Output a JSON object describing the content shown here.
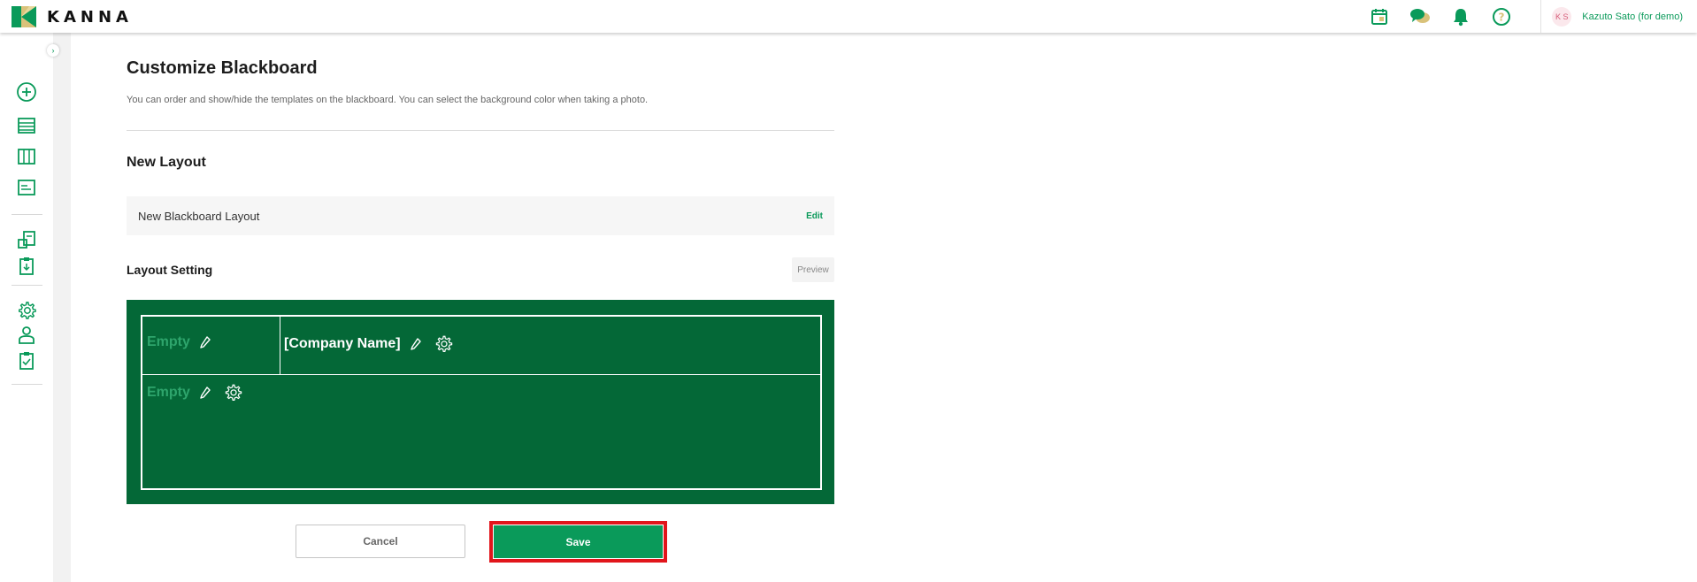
{
  "header": {
    "brand": "KANNA",
    "user_initials": "K S",
    "user_name": "Kazuto Sato (for demo)",
    "icons": [
      "calendar-icon",
      "chat-icon",
      "bell-icon",
      "help-icon"
    ]
  },
  "sidebar": {
    "toggle": "›",
    "icons": [
      "add-circle-icon",
      "list-icon",
      "columns-icon",
      "card-icon",
      "documents-icon",
      "clipboard-download-icon",
      "gear-icon",
      "user-icon",
      "clipboard-check-icon"
    ]
  },
  "page": {
    "title": "Customize Blackboard",
    "description": "You can order and show/hide the templates on the blackboard. You can select the background color when taking a photo."
  },
  "new_layout": {
    "section_title": "New Layout",
    "layout_name": "New Blackboard Layout",
    "edit_label": "Edit"
  },
  "layout_setting": {
    "section_title": "Layout Setting",
    "preview_label": "Preview"
  },
  "blackboard": {
    "background_color": "#046837",
    "cells": [
      {
        "label": "Empty"
      },
      {
        "label": "[Company Name]"
      },
      {
        "label": "Empty"
      }
    ]
  },
  "actions": {
    "cancel_label": "Cancel",
    "save_label": "Save"
  },
  "colors": {
    "accent": "#0a9a5a",
    "highlight": "#e1151b"
  }
}
